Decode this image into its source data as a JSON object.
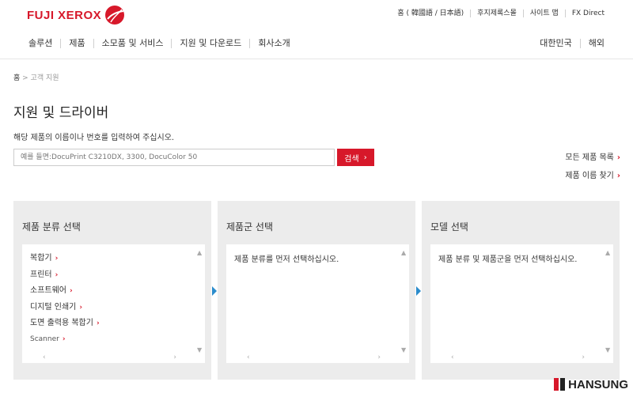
{
  "brand": {
    "name": "FUJI XEROX",
    "accent": "#d7182a",
    "link_accent": "#2b8ccc"
  },
  "util_nav": [
    "홈 ( 韓國語 / 日本語)",
    "후지제록스몰",
    "사이트 맵",
    "FX Direct"
  ],
  "global_nav": [
    "솔루션",
    "제품",
    "소모품 및 서비스",
    "지원 및 다운로드",
    "회사소개"
  ],
  "region_nav": [
    "대한민국",
    "해외"
  ],
  "breadcrumb": {
    "home": "홈",
    "separator": " > ",
    "current": "고객 지원"
  },
  "page_title": "지원 및 드라이버",
  "description": "해당 제품의 이름이나 번호를 입력하여 주십시오.",
  "search": {
    "placeholder": "예를 들면:DocuPrint C3210DX, 3300, DocuColor 50",
    "value": "",
    "button_label": "검색"
  },
  "side_links": [
    "모든 제품 목록",
    "제품 이름 찾기"
  ],
  "panels": {
    "category": {
      "title": "제품 분류 선택",
      "items": [
        "복합기",
        "프린터",
        "소프트웨어",
        "디지털 인쇄기",
        "도면 출력용 복합기",
        "Scanner"
      ]
    },
    "group": {
      "title": "제품군 선택",
      "message": "제품 분류를 먼저 선택하십시오."
    },
    "model": {
      "title": "모델 선택",
      "message": "제품 분류 및 제품군을 먼저 선택하십시오."
    }
  },
  "watermark": {
    "text": "HANSUNG"
  }
}
